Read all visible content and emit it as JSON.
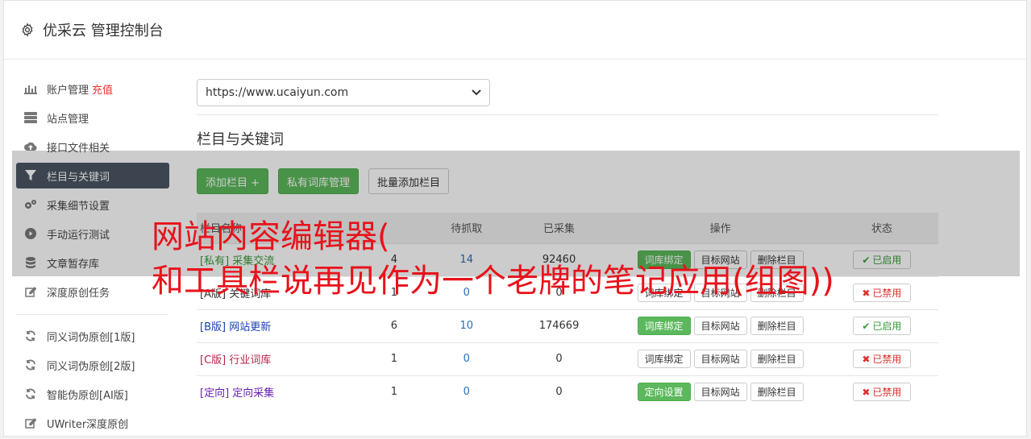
{
  "header": {
    "title": "优采云 管理控制台",
    "icon": "gear-icon"
  },
  "sidebar": {
    "items": [
      {
        "label": "账户管理",
        "badge": "充值",
        "icon": "bar-chart-icon"
      },
      {
        "label": "站点管理",
        "icon": "server-icon"
      },
      {
        "label": "接口文件相关",
        "icon": "cloud-upload-icon"
      },
      {
        "label": "栏目与关键词",
        "icon": "filter-icon",
        "active": true
      },
      {
        "label": "采集细节设置",
        "icon": "cogs-icon"
      },
      {
        "label": "手动运行测试",
        "icon": "play-circle-icon"
      },
      {
        "label": "文章暂存库",
        "icon": "database-icon"
      },
      {
        "label": "深度原创任务",
        "icon": "edit-icon"
      },
      {
        "label": "同义词伪原创[1版]",
        "icon": "refresh-icon"
      },
      {
        "label": "同义词伪原创[2版]",
        "icon": "refresh-icon"
      },
      {
        "label": "智能伪原创[AI版]",
        "icon": "refresh-icon"
      },
      {
        "label": "UWriter深度原创",
        "icon": "edit-icon"
      }
    ]
  },
  "main": {
    "site_select": "https://www.ucaiyun.com",
    "section_title": "栏目与关键词",
    "buttons": {
      "add": "添加栏目 +",
      "private": "私有词库管理",
      "batch": "批量添加栏目"
    },
    "table": {
      "headers": [
        "栏目名称",
        "待抓取",
        "已采集",
        "操作",
        "状态"
      ],
      "rows": [
        {
          "tag": "[私有]",
          "name": "采集交流",
          "pending": "4",
          "crawl": "14",
          "collected": "92460",
          "op1": "词库绑定",
          "op2": "目标网站",
          "op3": "删除栏目",
          "status": "已启用",
          "on": true,
          "color": "#3c9a3c",
          "op1green": true
        },
        {
          "tag": "[A版]",
          "name": "关键词库",
          "pending": "1",
          "crawl": "0",
          "collected": "0",
          "op1": "词库绑定",
          "op2": "目标网站",
          "op3": "删除栏目",
          "status": "已禁用",
          "on": false,
          "color": "#333333",
          "op1green": false
        },
        {
          "tag": "[B版]",
          "name": "网站更新",
          "pending": "6",
          "crawl": "10",
          "collected": "174669",
          "op1": "词库绑定",
          "op2": "目标网站",
          "op3": "删除栏目",
          "status": "已启用",
          "on": true,
          "color": "#1a3fb5",
          "op1green": true
        },
        {
          "tag": "[C版]",
          "name": "行业词库",
          "pending": "1",
          "crawl": "0",
          "collected": "0",
          "op1": "词库绑定",
          "op2": "目标网站",
          "op3": "删除栏目",
          "status": "已禁用",
          "on": false,
          "color": "#b5264a",
          "op1green": false
        },
        {
          "tag": "[定向]",
          "name": "定向采集",
          "pending": "1",
          "crawl": "0",
          "collected": "0",
          "op1": "定向设置",
          "op2": "目标网站",
          "op3": "删除栏目",
          "status": "已禁用",
          "on": false,
          "color": "#6a1fb0",
          "op1green": true
        }
      ]
    }
  },
  "overlay": {
    "line1": "网站内容编辑器(",
    "line2": "和工具栏说再见作为一个老牌的笔记应用(组图))",
    "color": "#e8121b"
  }
}
